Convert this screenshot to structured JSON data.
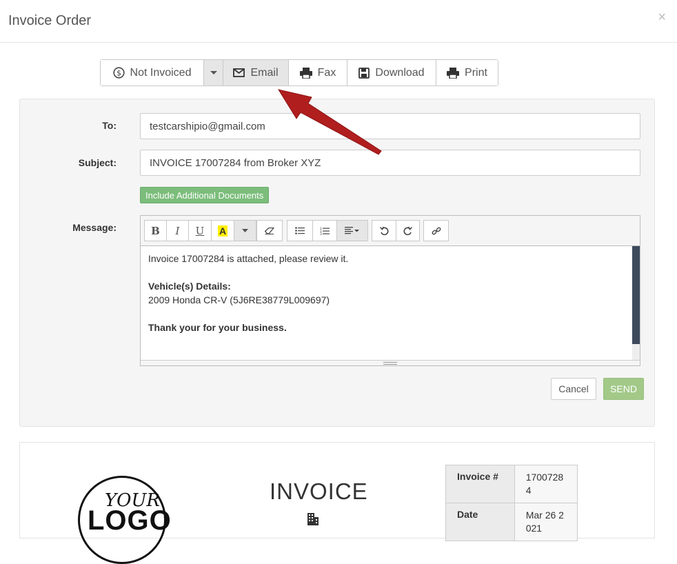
{
  "modal": {
    "title": "Invoice Order",
    "close": "×"
  },
  "actions": {
    "not_invoiced": "Not Invoiced",
    "email": "Email",
    "fax": "Fax",
    "download": "Download",
    "print": "Print"
  },
  "form": {
    "to_label": "To:",
    "to_value": "testcarshipio@gmail.com",
    "subject_label": "Subject:",
    "subject_value": "INVOICE 17007284 from Broker XYZ",
    "include_docs": "Include Additional Documents",
    "message_label": "Message:",
    "toolbar": {
      "bold": "B",
      "italic": "I",
      "underline": "U",
      "highlight": "A"
    },
    "message": {
      "line1": "Invoice 17007284 is attached, please review it.",
      "vehicle_heading": "Vehicle(s) Details:",
      "vehicle_line": "2009 Honda CR-V (5J6RE38779L009697)",
      "closing": "Thank your for your business."
    },
    "cancel": "Cancel",
    "send": "SEND"
  },
  "invoice": {
    "logo_line1": "YOUR",
    "logo_line2": "LOGO",
    "title": "INVOICE",
    "rows": [
      {
        "key": "Invoice #",
        "value": "17007284"
      },
      {
        "key": "Date",
        "value": "Mar 26 2021"
      }
    ]
  },
  "colors": {
    "arrow": "#b01e1e",
    "send": "#a3c989",
    "include_docs": "#7cbd7c",
    "scroll_thumb": "#3d4a5c"
  },
  "icons": [
    "dollar-circle-icon",
    "caret-down-icon",
    "envelope-icon",
    "fax-icon",
    "floppy-disk-icon",
    "printer-icon",
    "eraser-icon",
    "bullet-list-icon",
    "numbered-list-icon",
    "align-icon",
    "undo-icon",
    "redo-icon",
    "link-icon",
    "building-icon"
  ]
}
